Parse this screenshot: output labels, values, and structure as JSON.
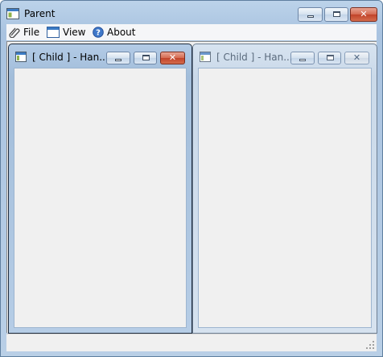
{
  "parent": {
    "title": "Parent",
    "accent_color": "#b9cfe6"
  },
  "menu": {
    "items": [
      {
        "label": "File",
        "icon": "paperclip-icon"
      },
      {
        "label": "View",
        "icon": "window-icon"
      },
      {
        "label": "About",
        "icon": "help-icon"
      }
    ]
  },
  "children": [
    {
      "title": "[ Child ] - Han...",
      "state": "active"
    },
    {
      "title": "[ Child ] - Han...",
      "state": "inactive"
    }
  ],
  "status": {
    "text": ""
  }
}
